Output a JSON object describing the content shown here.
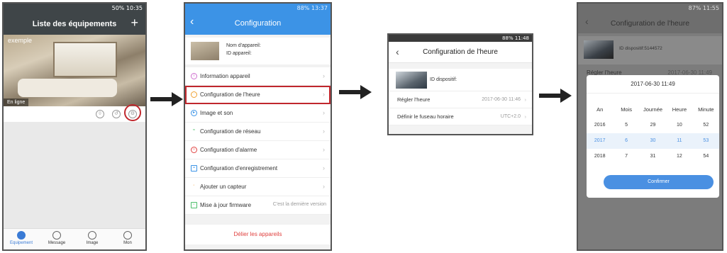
{
  "screen1": {
    "status": "50%  10:35",
    "title": "Liste des équipements",
    "add_label": "+",
    "device_name": "exemple",
    "online_label": "En ligne",
    "tabs": [
      {
        "label": "Equipement",
        "active": true
      },
      {
        "label": "Message",
        "active": false
      },
      {
        "label": "Image",
        "active": false
      },
      {
        "label": "Mon",
        "active": false
      }
    ]
  },
  "screen2": {
    "status": "88%  13:37",
    "title": "Configuration",
    "device_name_label": "Nom d'appareil:",
    "device_id_label": "ID appareil:",
    "menu": [
      {
        "label": "Information appareil",
        "icon": "info-icon",
        "color": "#d070d0"
      },
      {
        "label": "Configuration de l'heure",
        "icon": "clock-icon",
        "color": "#f0a030",
        "highlight": true
      },
      {
        "label": "Image et son",
        "icon": "play-icon",
        "color": "#3a93e6"
      },
      {
        "label": "Configuration de réseau",
        "icon": "wifi-icon",
        "color": "#4cbf6b"
      },
      {
        "label": "Configuration d'alarme",
        "icon": "bell-icon",
        "color": "#e0413f"
      },
      {
        "label": "Configuration d'enregistrement",
        "icon": "video-icon",
        "color": "#3a93e6"
      },
      {
        "label": "Ajouter un capteur",
        "icon": "sensor-icon",
        "color": "#f0a030"
      },
      {
        "label": "Mise à jour firmware",
        "icon": "firmware-icon",
        "color": "#4cbf6b",
        "sub": "C'est la dernière version"
      }
    ],
    "unbind_label": "Délier les appareils"
  },
  "screen3": {
    "status": "88%  11:48",
    "title": "Configuration de l'heure",
    "device_id": "ID dispositif:",
    "rows": [
      {
        "label": "Régler l'heure",
        "value": "2017-06-30 11:46"
      },
      {
        "label": "Définir le fuseau horaire",
        "value": "UTC+2.0"
      }
    ]
  },
  "screen4": {
    "status": "87%  11:55",
    "title": "Configuration de l'heure",
    "device_id": "ID dispositif:5144572",
    "set_time_label": "Régler l'heure",
    "set_time_value": "2017-06-30 11:49",
    "picker_title": "2017-06-30 11:49",
    "columns": [
      {
        "head": "An",
        "values": [
          "2016",
          "2017",
          "2018"
        ]
      },
      {
        "head": "Mois",
        "values": [
          "5",
          "6",
          "7"
        ]
      },
      {
        "head": "Journée",
        "values": [
          "29",
          "30",
          "31"
        ]
      },
      {
        "head": "Heure",
        "values": [
          "10",
          "11",
          "12"
        ]
      },
      {
        "head": "Minute",
        "values": [
          "52",
          "53",
          "54"
        ]
      }
    ],
    "confirm_label": "Confirmer"
  }
}
